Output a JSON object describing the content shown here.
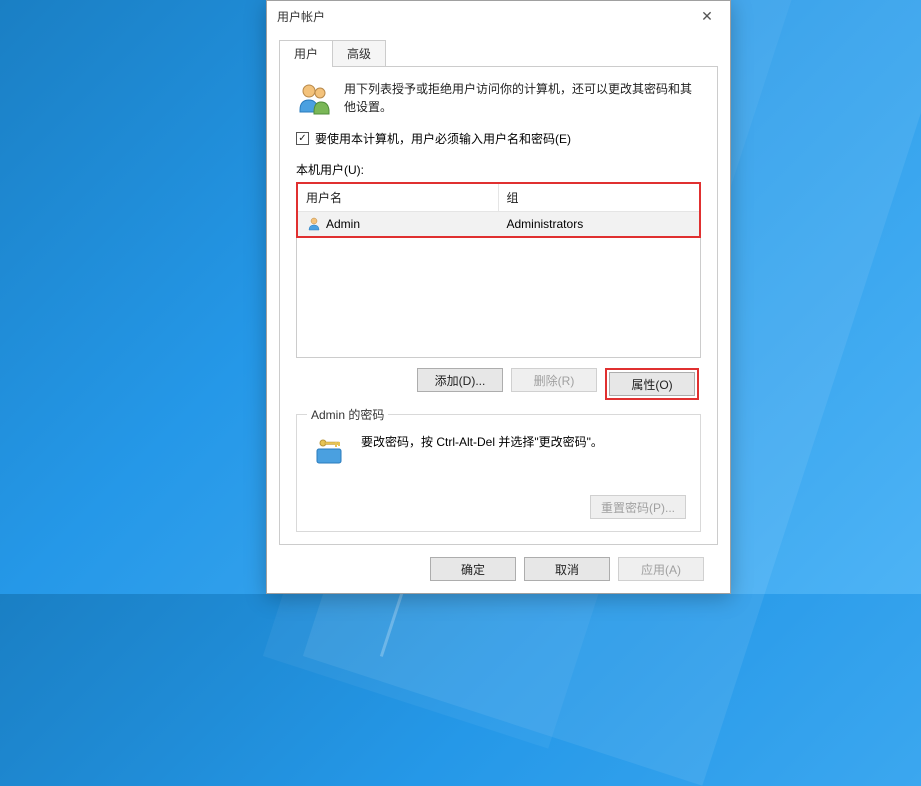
{
  "window": {
    "title": "用户帐户"
  },
  "tabs": {
    "users": "用户",
    "advanced": "高级"
  },
  "intro": "用下列表授予或拒绝用户访问你的计算机，还可以更改其密码和其他设置。",
  "checkbox": {
    "checked": true,
    "label": "要使用本计算机，用户必须输入用户名和密码(E)"
  },
  "users_label": "本机用户(U):",
  "table": {
    "headers": {
      "name": "用户名",
      "group": "组"
    },
    "rows": [
      {
        "name": "Admin",
        "group": "Administrators"
      }
    ]
  },
  "actions": {
    "add": "添加(D)...",
    "delete": "删除(R)",
    "properties": "属性(O)"
  },
  "password_group": {
    "title": "Admin 的密码",
    "hint": "要改密码，按 Ctrl-Alt-Del 并选择\"更改密码\"。",
    "reset": "重置密码(P)..."
  },
  "footer": {
    "ok": "确定",
    "cancel": "取消",
    "apply": "应用(A)"
  }
}
